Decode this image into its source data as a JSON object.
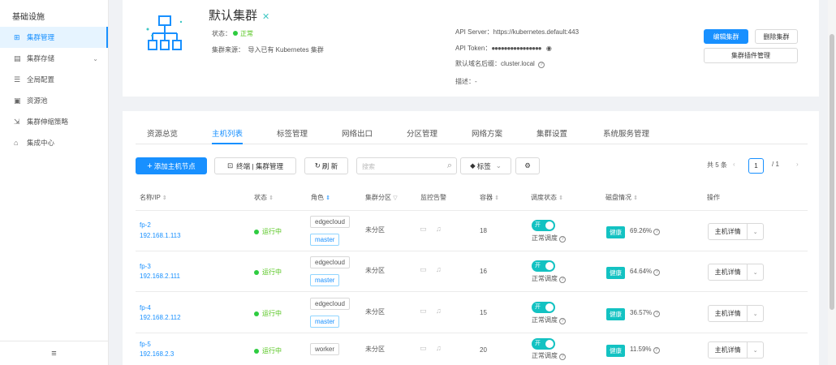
{
  "sidebar": {
    "title": "基础设施",
    "items": [
      {
        "label": "集群管理",
        "icon": "cluster-icon",
        "active": true
      },
      {
        "label": "集群存储",
        "icon": "storage-icon",
        "chevron": "⌄"
      },
      {
        "label": "全局配置",
        "icon": "sliders-icon"
      },
      {
        "label": "资源池",
        "icon": "pool-icon"
      },
      {
        "label": "集群伸缩策略",
        "icon": "scale-icon"
      },
      {
        "label": "集成中心",
        "icon": "integration-icon"
      }
    ],
    "collapse_icon": "≡"
  },
  "cluster": {
    "name": "默认集群",
    "status_label": "状态：",
    "status_value": "正常",
    "source_label": "集群来源：",
    "source_value": "导入已有 Kubernetes 集群",
    "api_server": "API Server：https://kubernetes.default:443",
    "api_token_label": "API Token：",
    "api_token_value": "●●●●●●●●●●●●●●●●",
    "domain": "默认域名后缀：cluster.local",
    "desc": "描述：-",
    "buttons": {
      "edit": "编辑集群",
      "delete": "删除集群",
      "plugins": "集群插件管理"
    }
  },
  "tabs": [
    "资源总览",
    "主机列表",
    "标签管理",
    "网络出口",
    "分区管理",
    "网络方案",
    "集群设置",
    "系统服务管理"
  ],
  "active_tab": 1,
  "toolbar": {
    "add": "添加主机节点",
    "terminal": "终端 | 集群管理",
    "refresh": "刷 新",
    "search_placeholder": "搜索",
    "tag_filter": "标签",
    "total": "共 5 条",
    "page": "1",
    "pages": "/ 1"
  },
  "columns": [
    "名称/IP",
    "状态",
    "角色",
    "集群分区",
    "监控告警",
    "容器",
    "调度状态",
    "磁盘情况",
    "操作"
  ],
  "rows": [
    {
      "name": "fp-2",
      "ip": "192.168.1.113",
      "status": "运行中",
      "roles": [
        "edgecloud",
        "master"
      ],
      "zone": "未分区",
      "containers": "18",
      "sched": "开",
      "sched_text": "正常调度",
      "health": "健康",
      "disk": "69.26%",
      "action": "主机详情"
    },
    {
      "name": "fp-3",
      "ip": "192.168.2.111",
      "status": "运行中",
      "roles": [
        "edgecloud",
        "master"
      ],
      "zone": "未分区",
      "containers": "16",
      "sched": "开",
      "sched_text": "正常调度",
      "health": "健康",
      "disk": "64.64%",
      "action": "主机详情"
    },
    {
      "name": "fp-4",
      "ip": "192.168.2.112",
      "status": "运行中",
      "roles": [
        "edgecloud",
        "master"
      ],
      "zone": "未分区",
      "containers": "15",
      "sched": "开",
      "sched_text": "正常调度",
      "health": "健康",
      "disk": "36.57%",
      "action": "主机详情"
    },
    {
      "name": "fp-5",
      "ip": "192.168.2.3",
      "status": "运行中",
      "roles": [
        "worker"
      ],
      "zone": "未分区",
      "containers": "20",
      "sched": "开",
      "sched_text": "正常调度",
      "health": "健康",
      "disk": "11.59%",
      "action": "主机详情"
    }
  ],
  "colors": {
    "accent": "#1890ff",
    "teal": "#13c2c2",
    "green": "#52c41a"
  }
}
